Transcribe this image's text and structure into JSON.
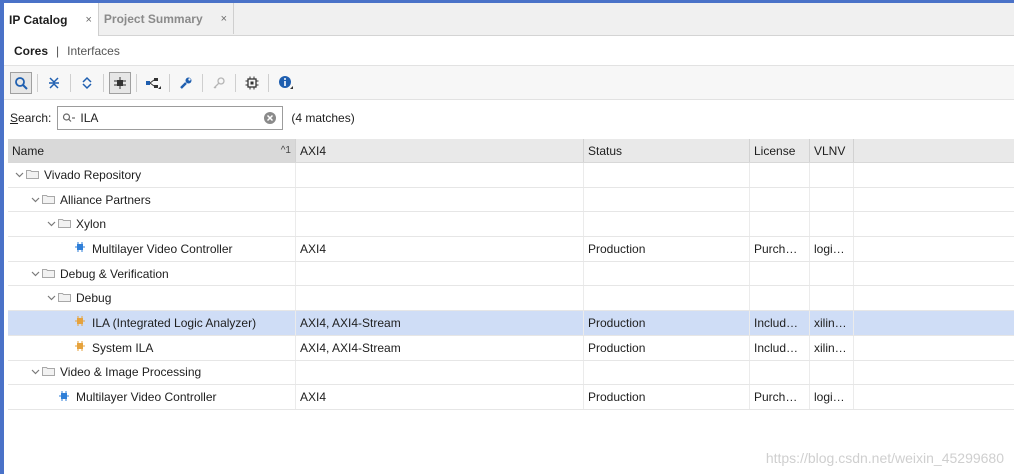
{
  "tabs": [
    {
      "label": "IP Catalog",
      "active": true
    },
    {
      "label": "Project Summary",
      "active": false
    }
  ],
  "close_glyph": "×",
  "subtabs": {
    "cores": "Cores",
    "separator": "|",
    "interfaces": "Interfaces"
  },
  "toolbar": {
    "icons": [
      "search-icon",
      "collapse-all-icon",
      "expand-all-icon",
      "hierarchy-icon",
      "group-icon",
      "wrench-icon",
      "key-icon",
      "chip-icon",
      "info-icon"
    ]
  },
  "search": {
    "label_accel": "S",
    "label_rest": "earch:",
    "value": "ILA",
    "matches": "(4 matches)"
  },
  "table": {
    "headers": {
      "name": "Name",
      "sort": "^1",
      "interfaces": "AXI4",
      "status": "Status",
      "license": "License",
      "vlnv": "VLNV"
    },
    "rows": [
      {
        "level": 0,
        "type": "folder",
        "name": "Vivado Repository"
      },
      {
        "level": 1,
        "type": "folder",
        "name": "Alliance Partners"
      },
      {
        "level": 2,
        "type": "folder",
        "name": "Xylon"
      },
      {
        "level": 3,
        "type": "ip",
        "icon": "blue",
        "name": "Multilayer Video Controller",
        "interfaces": "AXI4",
        "status": "Production",
        "license": "Purch…",
        "vlnv": "logi…"
      },
      {
        "level": 1,
        "type": "folder",
        "name": "Debug & Verification"
      },
      {
        "level": 2,
        "type": "folder",
        "name": "Debug"
      },
      {
        "level": 3,
        "type": "ip",
        "icon": "orange",
        "name": "ILA (Integrated Logic Analyzer)",
        "interfaces": "AXI4, AXI4-Stream",
        "status": "Production",
        "license": "Includ…",
        "vlnv": "xilin…",
        "selected": true
      },
      {
        "level": 3,
        "type": "ip",
        "icon": "orange",
        "name": "System ILA",
        "interfaces": "AXI4, AXI4-Stream",
        "status": "Production",
        "license": "Includ…",
        "vlnv": "xilin…"
      },
      {
        "level": 1,
        "type": "folder",
        "name": "Video & Image Processing"
      },
      {
        "level": 2,
        "type": "ip",
        "icon": "blue",
        "name": "Multilayer Video Controller",
        "interfaces": "AXI4",
        "status": "Production",
        "license": "Purch…",
        "vlnv": "logi…"
      }
    ]
  },
  "colors": {
    "accent": "#4a72c8",
    "selected_row": "#cfddf6",
    "ip_blue": "#2f7fd8",
    "ip_orange": "#e6a23c"
  },
  "watermark": "https://blog.csdn.net/weixin_45299680"
}
